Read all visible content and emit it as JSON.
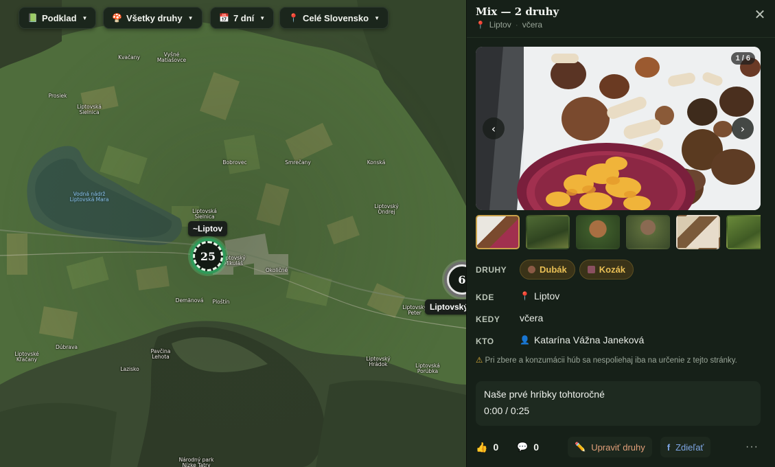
{
  "map": {
    "controls": [
      {
        "icon": "📗",
        "label": "Podklad"
      },
      {
        "icon": "🍄",
        "label": "Všetky druhy"
      },
      {
        "icon": "📅",
        "label": "7 dní"
      },
      {
        "icon": "📍",
        "label": "Celé Slovensko"
      }
    ],
    "places": [
      {
        "name": "Kvačany"
      },
      {
        "name": "Vyšné\nMatiašovce"
      },
      {
        "name": "Prosiek"
      },
      {
        "name": "Liptovská\nSielnica"
      },
      {
        "name": "Bobrovec"
      },
      {
        "name": "Smrečany"
      },
      {
        "name": "Konská"
      },
      {
        "name": "Vodná nádrž\nLiptovská Mara",
        "water": true
      },
      {
        "name": "Liptovský\nOndrej"
      },
      {
        "name": "Liptovská\nSielnica"
      },
      {
        "name": "Liptovský\nMikuláš"
      },
      {
        "name": "Okoličné"
      },
      {
        "name": "Demänová"
      },
      {
        "name": "Ploštín"
      },
      {
        "name": "Liptovský\nPeter"
      },
      {
        "name": "Dúbrava"
      },
      {
        "name": "Liptovské\nKľačany"
      },
      {
        "name": "Pavčina\nLehota"
      },
      {
        "name": "Lazisko"
      },
      {
        "name": "Liptovský\nHrádok"
      },
      {
        "name": "Liptovská\nPorúbka"
      },
      {
        "name": "Národný park\nNízke Tatry"
      }
    ],
    "clusters": [
      {
        "count": "25",
        "label": "~Liptov"
      },
      {
        "count": "6",
        "label": "Liptovský"
      }
    ]
  },
  "panel": {
    "title": "Mix — 2 druhy",
    "location": "Liptov",
    "when": "včera",
    "gallery": {
      "counter": "1 / 6",
      "thumb_count": 6
    },
    "species_label": "DRUHY",
    "species": [
      {
        "name": "Dubák",
        "color": "#8a5a45",
        "shape": "dot"
      },
      {
        "name": "Kozák",
        "color": "#8a5060",
        "shape": "square"
      }
    ],
    "where_label": "KDE",
    "where_value": "Liptov",
    "when_label": "KEDY",
    "when_value": "včera",
    "who_label": "KTO",
    "who_value": "Katarína Vážna Janeková",
    "warning": "Pri zbere a konzumácii húb sa nespoliehaj iba na určenie z tejto stránky.",
    "audio": {
      "title": "Naše prvé hríbky tohtoročné",
      "time": "0:00 / 0:25"
    },
    "actions": {
      "likes": "0",
      "comments": "0",
      "edit_label": "Upraviť druhy",
      "share_label": "Zdieľať",
      "more": "···"
    }
  }
}
